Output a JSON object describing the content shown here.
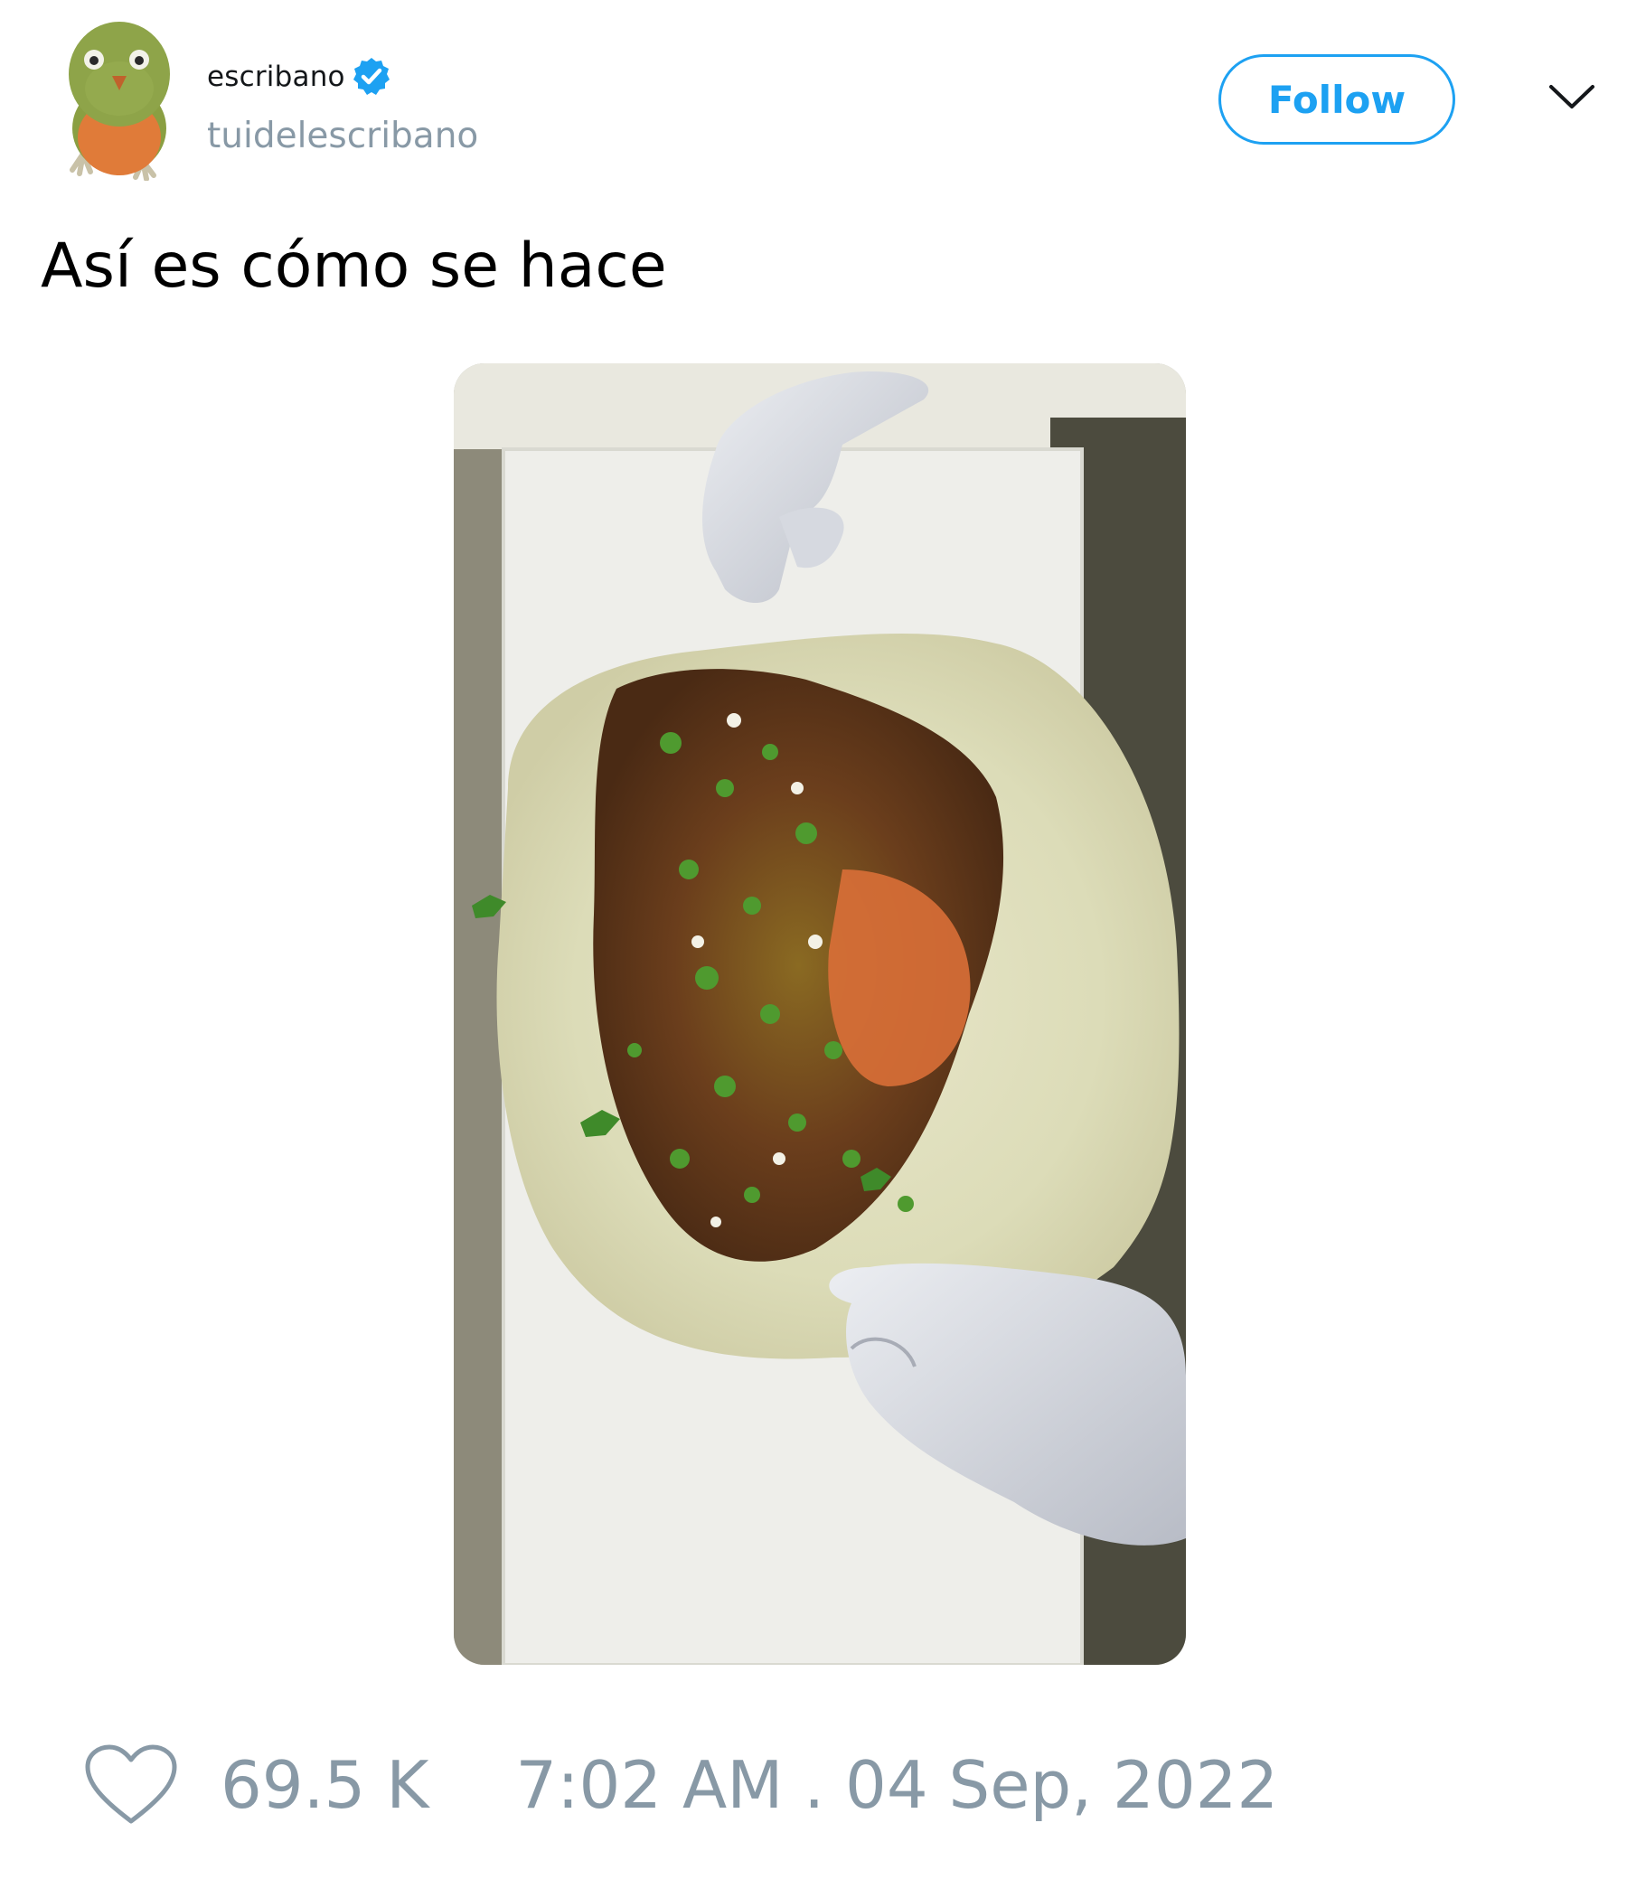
{
  "author": {
    "display_name": "escribano",
    "handle": "tuidelescribano",
    "verified": true,
    "avatar_icon": "bird-avatar-icon"
  },
  "actions": {
    "follow_label": "Follow",
    "menu_icon": "chevron-down-icon"
  },
  "tweet": {
    "text": "Así es cómo se hace",
    "media_icon": "video-thumbnail"
  },
  "footer": {
    "like_icon": "heart-icon",
    "like_count": "69.5 K",
    "timestamp": "7:02 AM . 04 Sep, 2022"
  },
  "colors": {
    "accent": "#1da1f2",
    "muted_text": "#8899a6",
    "primary_text": "#14171a"
  }
}
